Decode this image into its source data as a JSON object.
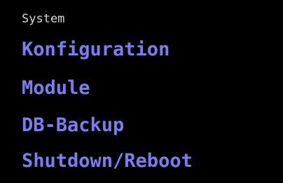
{
  "menu": {
    "section_title": "System",
    "items": [
      {
        "label": "Konfiguration"
      },
      {
        "label": "Module"
      },
      {
        "label": "DB-Backup"
      },
      {
        "label": "Shutdown/Reboot"
      }
    ]
  },
  "colors": {
    "background": "#000000",
    "section_title": "#d8d8d8",
    "link": "#7e7cf3"
  }
}
